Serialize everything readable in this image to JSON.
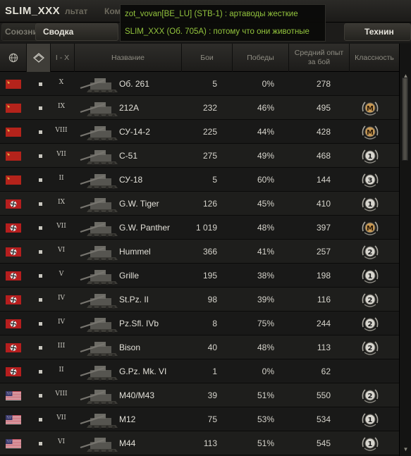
{
  "window": {
    "title": "SLIM_XXX"
  },
  "tabs": {
    "summary": "Сводка",
    "allies": "Союзни",
    "tech": "Технин",
    "ghost1": "льтат",
    "ghost2": "Ком"
  },
  "chat": [
    {
      "text": "zot_vovan[BE_LU] (STB-1) : артаводы жесткие"
    },
    {
      "text": "SLIM_XXX (Об. 705А) : потому что они животные"
    }
  ],
  "header": {
    "tier": "I - X",
    "name": "Название",
    "battles": "Бои",
    "wins": "Победы",
    "avgxp": "Средний опыт за бой",
    "mastery": "Классность"
  },
  "colors": {
    "ussr": "#b4231b",
    "germany": "#b61e1e",
    "usa_red": "#b22234",
    "usa_blue": "#3c3b6e",
    "chat_text": "#93c43d"
  },
  "rows": [
    {
      "nation": "ussr",
      "tier": "X",
      "name": "Об. 261",
      "battles": "5",
      "wins": "0%",
      "xp": "278",
      "mastery": ""
    },
    {
      "nation": "ussr",
      "tier": "IX",
      "name": "212A",
      "battles": "232",
      "wins": "46%",
      "xp": "495",
      "mastery": "M"
    },
    {
      "nation": "ussr",
      "tier": "VIII",
      "name": "СУ-14-2",
      "battles": "225",
      "wins": "44%",
      "xp": "428",
      "mastery": "M"
    },
    {
      "nation": "ussr",
      "tier": "VII",
      "name": "С-51",
      "battles": "275",
      "wins": "49%",
      "xp": "468",
      "mastery": "1"
    },
    {
      "nation": "ussr",
      "tier": "II",
      "name": "СУ-18",
      "battles": "5",
      "wins": "60%",
      "xp": "144",
      "mastery": "3"
    },
    {
      "nation": "germany",
      "tier": "IX",
      "name": "G.W. Tiger",
      "battles": "126",
      "wins": "45%",
      "xp": "410",
      "mastery": "1"
    },
    {
      "nation": "germany",
      "tier": "VII",
      "name": "G.W. Panther",
      "battles": "1 019",
      "wins": "48%",
      "xp": "397",
      "mastery": "M"
    },
    {
      "nation": "germany",
      "tier": "VI",
      "name": "Hummel",
      "battles": "366",
      "wins": "41%",
      "xp": "257",
      "mastery": "2"
    },
    {
      "nation": "germany",
      "tier": "V",
      "name": "Grille",
      "battles": "195",
      "wins": "38%",
      "xp": "198",
      "mastery": "1"
    },
    {
      "nation": "germany",
      "tier": "IV",
      "name": "St.Pz. II",
      "battles": "98",
      "wins": "39%",
      "xp": "116",
      "mastery": "2"
    },
    {
      "nation": "germany",
      "tier": "IV",
      "name": "Pz.Sfl. IVb",
      "battles": "8",
      "wins": "75%",
      "xp": "244",
      "mastery": "2"
    },
    {
      "nation": "germany",
      "tier": "III",
      "name": "Bison",
      "battles": "40",
      "wins": "48%",
      "xp": "113",
      "mastery": "2"
    },
    {
      "nation": "germany",
      "tier": "II",
      "name": "G.Pz. Mk. VI",
      "battles": "1",
      "wins": "0%",
      "xp": "62",
      "mastery": ""
    },
    {
      "nation": "usa",
      "tier": "VIII",
      "name": "M40/M43",
      "battles": "39",
      "wins": "51%",
      "xp": "550",
      "mastery": "2"
    },
    {
      "nation": "usa",
      "tier": "VII",
      "name": "M12",
      "battles": "75",
      "wins": "53%",
      "xp": "534",
      "mastery": "1"
    },
    {
      "nation": "usa",
      "tier": "VI",
      "name": "M44",
      "battles": "113",
      "wins": "51%",
      "xp": "545",
      "mastery": "1"
    }
  ]
}
